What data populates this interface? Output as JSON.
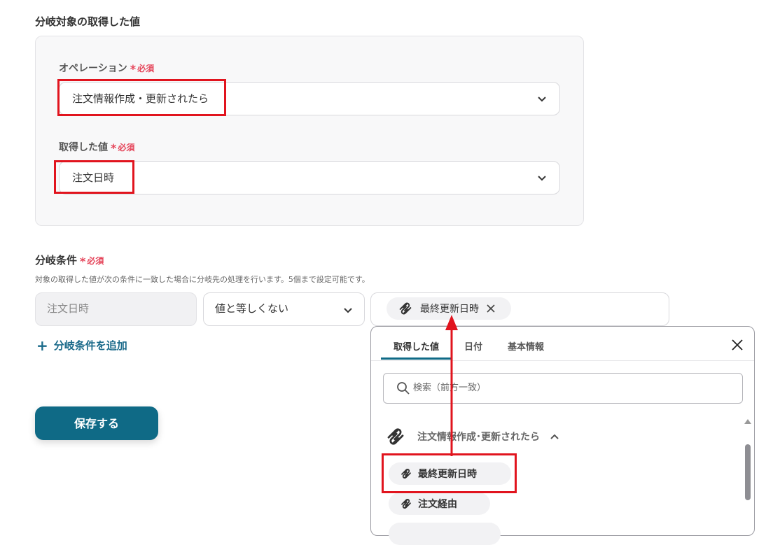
{
  "source_section": {
    "title": "分岐対象の取得した値",
    "operation": {
      "label": "オペレーション",
      "required": "必須",
      "value": "注文情報作成・更新されたら"
    },
    "acquired_value": {
      "label": "取得した値",
      "required": "必須",
      "value": "注文日時"
    }
  },
  "condition_section": {
    "title": "分岐条件",
    "required": "必須",
    "description": "対象の取得した値が次の条件に一致した場合に分岐先の処理を行います。5個まで設定可能です。",
    "field_value": "注文日時",
    "operator": "値と等しくない",
    "chip_label": "最終更新日時",
    "add_label": "分岐条件を追加"
  },
  "save_label": "保存する",
  "popup": {
    "tabs": [
      "取得した値",
      "日付",
      "基本情報"
    ],
    "active_tab": 0,
    "search_placeholder": "検索（前方一致）",
    "group_label": "注文情報作成･更新されたら",
    "items": [
      "最終更新日時",
      "注文経由"
    ]
  },
  "colors": {
    "accent": "#0f6a86",
    "required": "#e5455a",
    "highlight": "#e1141e"
  }
}
